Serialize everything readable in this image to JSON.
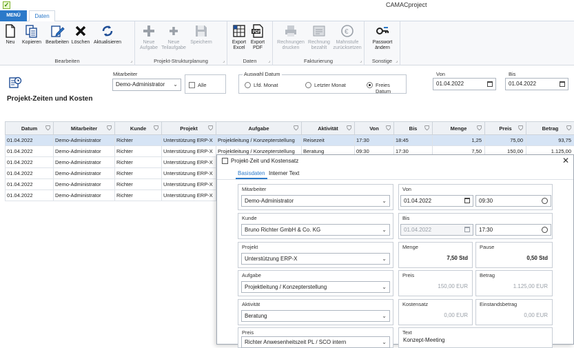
{
  "app": {
    "title": "CAMACproject"
  },
  "tabs": {
    "menu": "MENÜ",
    "daten": "Daten"
  },
  "ribbon": {
    "groups": {
      "bearbeiten": "Bearbeiten",
      "struktur": "Projekt-Strukturplanung",
      "daten": "Daten",
      "fakt": "Fakturierung",
      "sonstige": "Sonstige"
    },
    "buttons": {
      "neu": "Neu",
      "kopieren": "Kopieren",
      "bearbeiten": "Bearbeiten",
      "loeschen": "Löschen",
      "aktualisieren": "Aktualisieren",
      "neue_aufgabe_1": "Neue",
      "neue_aufgabe_2": "Aufgabe",
      "neue_teil_1": "Neue",
      "neue_teil_2": "Teilaufgabe",
      "speichern": "Speichern",
      "export_excel_1": "Export",
      "export_excel_2": "Excel",
      "export_pdf_1": "Export",
      "export_pdf_2": "PDF",
      "rech_druck_1": "Rechnungen",
      "rech_druck_2": "drucken",
      "rech_bez_1": "Rechnung",
      "rech_bez_2": "bezahlt",
      "mahn_1": "Mahnstufe",
      "mahn_2": "zurücksetzen",
      "pw_1": "Passwort",
      "pw_2": "ändern"
    }
  },
  "filter": {
    "page_title": "Projekt-Zeiten und Kosten",
    "mitarbeiter_label": "Mitarbeiter",
    "mitarbeiter_value": "Demo-Administrator",
    "alle_label": "Alle",
    "auswahl_label": "Auswahl Datum",
    "opt_lfd": "Lfd. Monat",
    "opt_letzter": "Letzter Monat",
    "opt_frei": "Freies Datum",
    "von_label": "Von",
    "von_value": "01.04.2022",
    "bis_label": "Bis",
    "bis_value": "01.04.2022"
  },
  "grid": {
    "columns": [
      "Datum",
      "Mitarbeiter",
      "Kunde",
      "Projekt",
      "Aufgabe",
      "Aktivität",
      "Von",
      "Bis",
      "Menge",
      "Preis",
      "Betrag"
    ],
    "rows": [
      [
        "01.04.2022",
        "Demo-Administrator",
        "Richter",
        "Unterstützung ERP-X",
        "Projektleitung / Konzepterstellung",
        "Reisezeit",
        "17:30",
        "18:45",
        "1,25",
        "75,00",
        "93,75"
      ],
      [
        "01.04.2022",
        "Demo-Administrator",
        "Richter",
        "Unterstützung ERP-X",
        "Projektleitung / Konzepterstellung",
        "Beratung",
        "09:30",
        "17:30",
        "7,50",
        "150,00",
        "1.125,00"
      ],
      [
        "01.04.2022",
        "Demo-Administrator",
        "Richter",
        "Unterstützung ERP-X",
        "",
        "",
        "",
        "",
        "",
        "",
        ""
      ],
      [
        "01.04.2022",
        "Demo-Administrator",
        "Richter",
        "Unterstützung ERP-X",
        "",
        "",
        "",
        "",
        "",
        "",
        ""
      ],
      [
        "01.04.2022",
        "Demo-Administrator",
        "Richter",
        "Unterstützung ERP-X",
        "",
        "",
        "",
        "",
        "",
        "",
        ""
      ],
      [
        "01.04.2022",
        "Demo-Administrator",
        "Richter",
        "Unterstützung ERP-X",
        "",
        "",
        "",
        "",
        "",
        "",
        ""
      ]
    ]
  },
  "dialog": {
    "title": "Projekt-Zeit und Kostensatz",
    "tab_basis": "Basisdaten",
    "tab_intern": "Interner Text",
    "mitarbeiter_label": "Mitarbeiter",
    "mitarbeiter_value": "Demo-Administrator",
    "von_label": "Von",
    "von_date": "01.04.2022",
    "von_time": "09:30",
    "kunde_label": "Kunde",
    "kunde_value": "Bruno Richter GmbH & Co. KG",
    "bis_label": "Bis",
    "bis_date": "01.04.2022",
    "bis_time": "17:30",
    "projekt_label": "Projekt",
    "projekt_value": "Unterstützung ERP-X",
    "menge_label": "Menge",
    "menge_value": "7,50 Std",
    "pause_label": "Pause",
    "pause_value": "0,50 Std",
    "aufgabe_label": "Aufgabe",
    "aufgabe_value": "Projektleitung / Konzepterstellung",
    "preis_label": "Preis",
    "preis_value": "150,00 EUR",
    "betrag_label": "Betrag",
    "betrag_value": "1.125,00 EUR",
    "aktivitaet_label": "Aktivität",
    "aktivitaet_value": "Beratung",
    "kostensatz_label": "Kostensatz",
    "kostensatz_value": "0,00 EUR",
    "einstand_label": "Einstandsbetrag",
    "einstand_value": "0,00 EUR",
    "preisart_label": "Preis",
    "preisart_value": "Richter Anwesenheitszeit PL / SCO intern",
    "text_label": "Text",
    "text_value": "Konzept-Meeting"
  }
}
